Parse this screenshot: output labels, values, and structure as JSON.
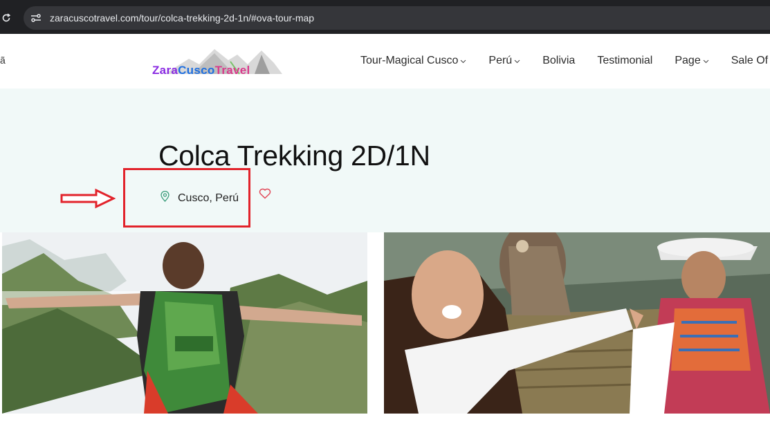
{
  "browser": {
    "url": "zaracuscotravel.com/tour/colca-trekking-2d-1n/#ova-tour-map"
  },
  "header": {
    "edge_glyph": "ã",
    "logo": {
      "text_parts": [
        "Zara",
        "Cusco",
        "Travel"
      ],
      "colors": [
        "#8a2be2",
        "#1e6fe0",
        "#d93b8c"
      ]
    },
    "nav": [
      {
        "label": "Tour-Magical Cusco",
        "dropdown": true
      },
      {
        "label": "Perú",
        "dropdown": true
      },
      {
        "label": "Bolivia",
        "dropdown": false
      },
      {
        "label": "Testimonial",
        "dropdown": false
      },
      {
        "label": "Page",
        "dropdown": true
      },
      {
        "label": "Sale Of",
        "dropdown": false
      }
    ]
  },
  "tour": {
    "title": "Colca Trekking 2D/1N",
    "location": "Cusco, Perú"
  },
  "colors": {
    "hero_bg": "#f1f9f8",
    "accent_green": "#3a9d7a",
    "annotation_red": "#e2232b",
    "heart_red": "#e24a5a"
  },
  "gallery": {
    "images": [
      {
        "subject": "hiker with green backpack, arms outstretched facing mountains"
      },
      {
        "subject": "smiling woman with eagle and local woman in traditional dress"
      }
    ]
  }
}
